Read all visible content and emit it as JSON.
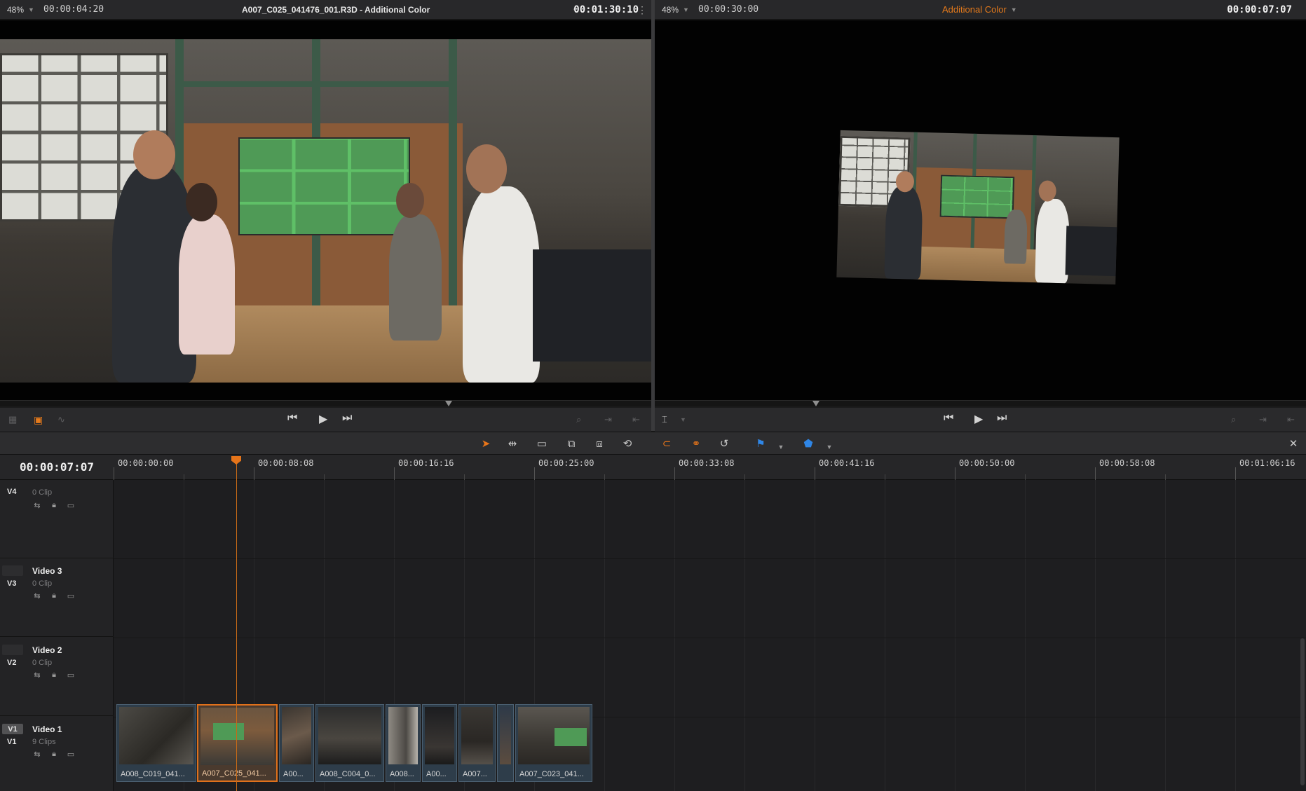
{
  "source": {
    "zoom": "48%",
    "duration": "00:00:04:20",
    "clip_title": "A007_C025_041476_001.R3D - Additional Color",
    "timecode": "00:01:30:10"
  },
  "timeline_viewer": {
    "zoom": "48%",
    "duration": "00:00:30:00",
    "mode": "Additional Color",
    "timecode": "00:00:07:07"
  },
  "timeline": {
    "current_timecode": "00:00:07:07",
    "ruler_labels": [
      "00:00:00:00",
      "00:00:08:08",
      "00:00:16:16",
      "00:00:25:00",
      "00:00:33:08",
      "00:00:41:16",
      "00:00:50:00",
      "00:00:58:08",
      "00:01:06:16"
    ],
    "tracks": [
      {
        "id": "V4",
        "name": "",
        "clips": "0 Clip"
      },
      {
        "id": "V3",
        "name": "Video 3",
        "clips": "0 Clip"
      },
      {
        "id": "V2",
        "name": "Video 2",
        "clips": "0 Clip"
      },
      {
        "id": "V1",
        "name": "Video 1",
        "clips": "9 Clips"
      }
    ],
    "v1_clips": [
      {
        "label": "A008_C019_041..."
      },
      {
        "label": "A007_C025_041..."
      },
      {
        "label": "A00..."
      },
      {
        "label": "A008_C004_0..."
      },
      {
        "label": "A008..."
      },
      {
        "label": "A00..."
      },
      {
        "label": "A007..."
      },
      {
        "label": ""
      },
      {
        "label": "A007_C023_041..."
      }
    ]
  },
  "icons": {
    "prev": "skip-back-icon",
    "play": "play-icon",
    "next": "skip-forward-icon",
    "selection": "arrow-pointer-icon",
    "trim": "trim-icon",
    "blade": "blade-icon",
    "snap": "snap-icon",
    "link": "link-icon",
    "loop": "loop-icon",
    "flag": "flag-icon",
    "marker": "marker-icon"
  },
  "colors": {
    "accent_orange": "#e5741a",
    "flag_blue": "#2f86e6"
  }
}
